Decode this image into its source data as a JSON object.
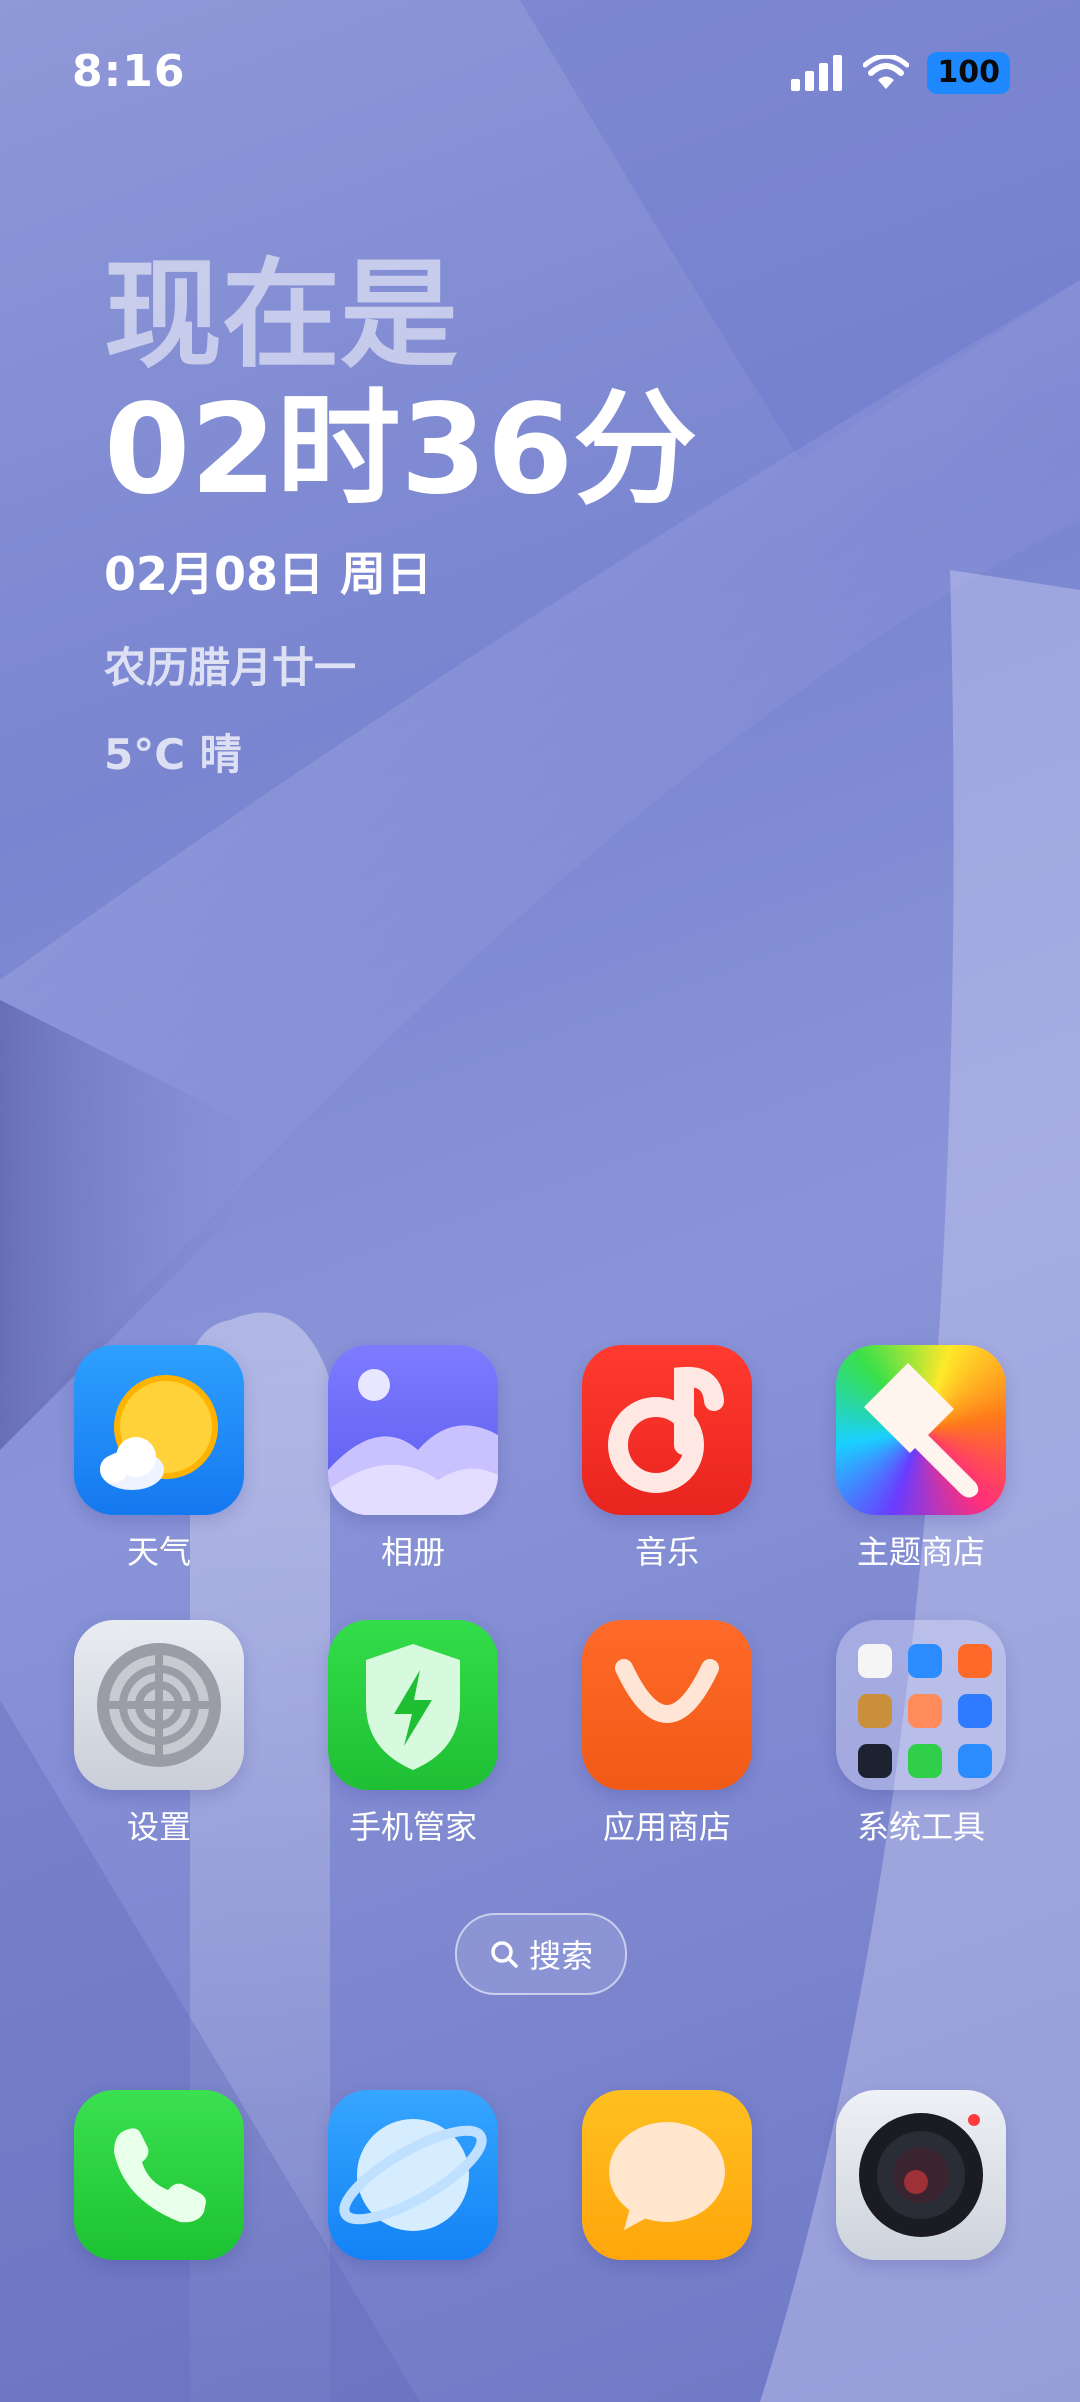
{
  "status_bar": {
    "time": "8:16",
    "battery": "100",
    "icons": [
      "signal-icon",
      "wifi-icon",
      "battery-icon"
    ]
  },
  "widget": {
    "line1": "现在是",
    "line2": "02时36分",
    "date": "02月08日  周日",
    "lunar": "农历腊月廿一",
    "weather": "5°C 晴"
  },
  "apps": [
    {
      "label": "天气",
      "icon": "weather-icon"
    },
    {
      "label": "相册",
      "icon": "gallery-icon"
    },
    {
      "label": "音乐",
      "icon": "music-icon"
    },
    {
      "label": "主题商店",
      "icon": "theme-store-icon"
    },
    {
      "label": "设置",
      "icon": "settings-icon"
    },
    {
      "label": "手机管家",
      "icon": "phone-manager-icon"
    },
    {
      "label": "应用商店",
      "icon": "app-store-icon"
    },
    {
      "label": "系统工具",
      "icon": "folder-icon"
    }
  ],
  "search": {
    "label": "搜索",
    "icon": "search-icon"
  },
  "dock": [
    {
      "icon": "phone-icon"
    },
    {
      "icon": "browser-icon"
    },
    {
      "icon": "messages-icon"
    },
    {
      "icon": "camera-icon"
    }
  ],
  "colors": {
    "accent_battery": "#1e88ff"
  }
}
